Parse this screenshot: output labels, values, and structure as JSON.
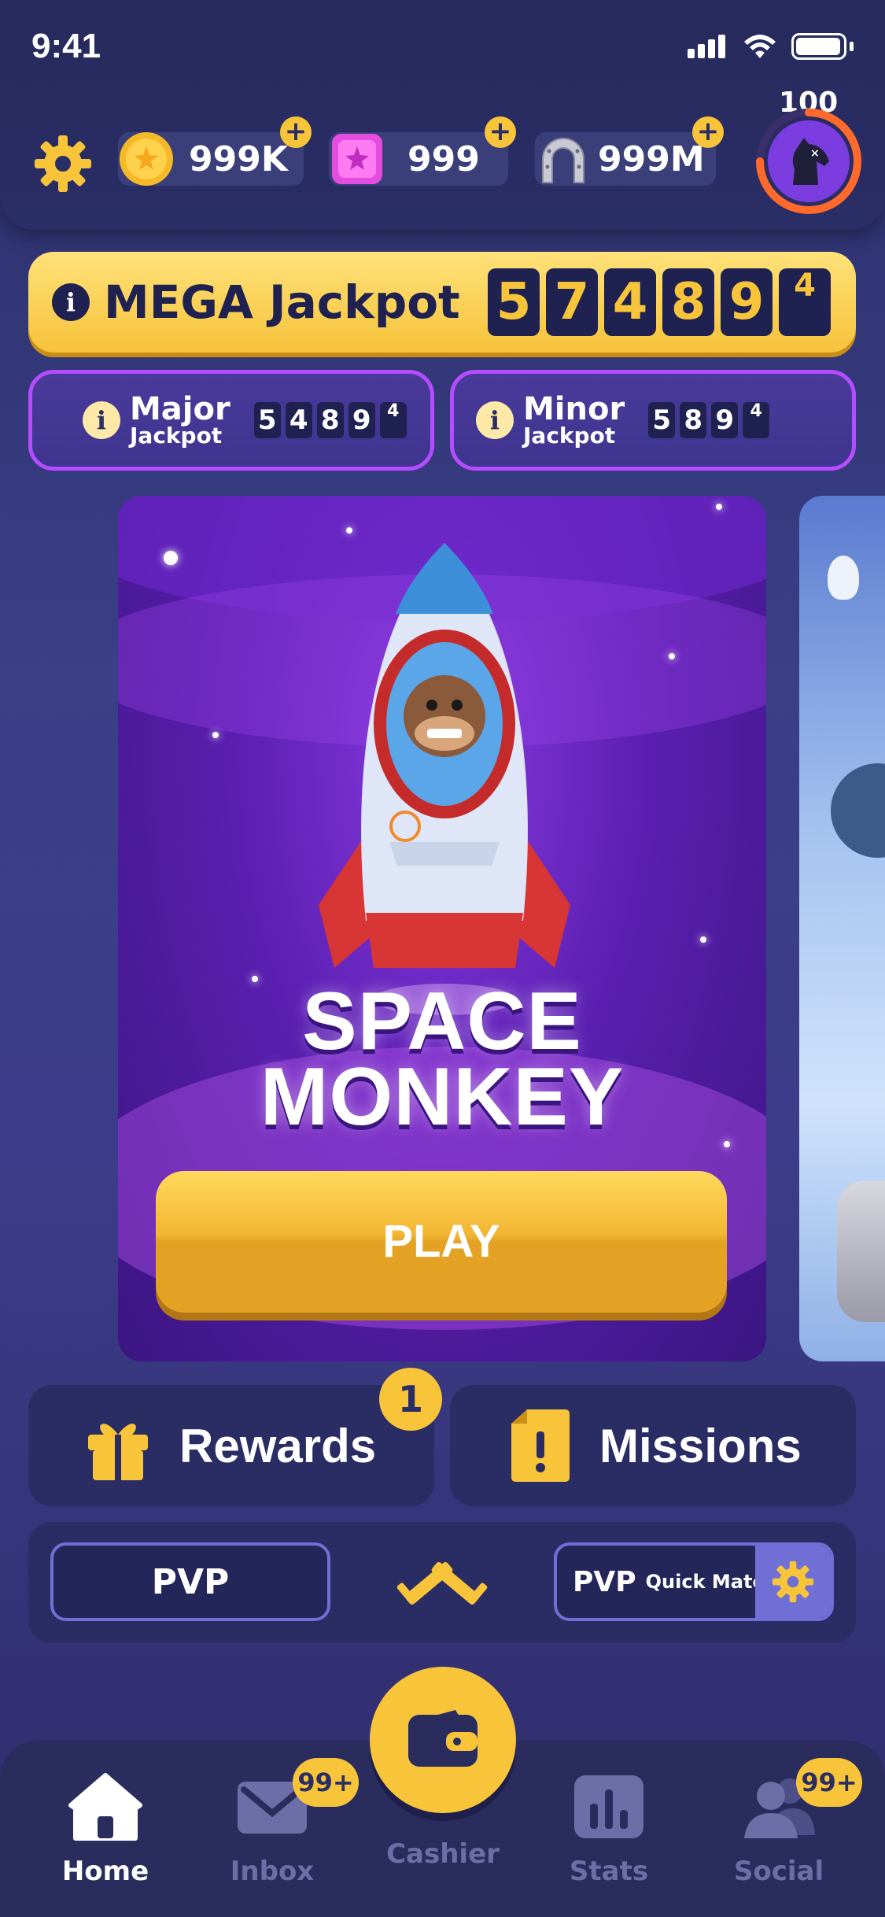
{
  "status_bar": {
    "time": "9:41"
  },
  "currencies": [
    {
      "name": "coins",
      "value": "999K",
      "icon": "coin-icon",
      "color": "#f8c43a"
    },
    {
      "name": "gems",
      "value": "999",
      "icon": "gem-icon",
      "color": "#e44de0"
    },
    {
      "name": "horseshoes",
      "value": "999M",
      "icon": "horseshoe-icon",
      "color": "#c9c9d3"
    }
  ],
  "player": {
    "level": "100",
    "level_progress": 0.75
  },
  "mega_jackpot": {
    "title": "MEGA Jackpot",
    "digits": [
      "5",
      "7",
      "4",
      "8",
      "9",
      "4"
    ]
  },
  "major_jackpot": {
    "line1": "Major",
    "line2": "Jackpot",
    "digits": [
      "5",
      "4",
      "8",
      "9",
      "4"
    ]
  },
  "minor_jackpot": {
    "line1": "Minor",
    "line2": "Jackpot",
    "digits": [
      "5",
      "8",
      "9",
      "4"
    ]
  },
  "featured_game": {
    "title_line1": "SPACE",
    "title_line2": "MONKEY",
    "play_label": "PLAY"
  },
  "rewards": {
    "label": "Rewards",
    "count": "1"
  },
  "missions": {
    "label": "Missions"
  },
  "pvp": {
    "label": "PVP",
    "quick_label": "PVP",
    "quick_sub": "Quick Match"
  },
  "tabs": {
    "home": "Home",
    "inbox": "Inbox",
    "inbox_badge": "99+",
    "cashier": "Cashier",
    "stats": "Stats",
    "social": "Social",
    "social_badge": "99+"
  },
  "colors": {
    "accent": "#f8c43a",
    "bg": "#2b2f6a",
    "jackpot_border": "#b54cff"
  }
}
